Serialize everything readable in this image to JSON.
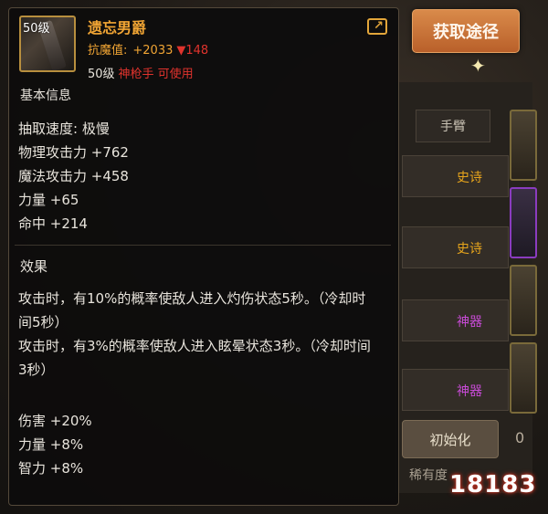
{
  "background": {
    "tab_weapon": "手臂",
    "rarity_rows": [
      {
        "label": "史诗",
        "color": "#e6a41c"
      },
      {
        "label": "史诗",
        "color": "#e6a41c"
      },
      {
        "label": "神器",
        "color": "#c84bd6"
      },
      {
        "label": "神器",
        "color": "#c84bd6"
      }
    ],
    "init_button": "初始化",
    "rarity_footer": "稀有度",
    "level_partial": "0"
  },
  "obtain_button": "获取途径",
  "item": {
    "icon_level": "50级",
    "name": "遗忘男爵",
    "resist_label": "抗魔值:",
    "resist_value": "+2033",
    "resist_diff": "▼148",
    "req_level": "50级",
    "req_class": "神枪手 可使用"
  },
  "basic_info": {
    "title": "基本信息",
    "stats": [
      "抽取速度: 极慢",
      "物理攻击力 +762",
      "魔法攻击力 +458",
      "力量 +65",
      "命中 +214"
    ]
  },
  "effects": {
    "title": "效果",
    "lines": [
      "攻击时，有10%的概率使敌人进入灼伤状态5秒。（冷却时间5秒）",
      "攻击时，有3%的概率使敌人进入眩晕状态3秒。（冷却时间3秒）"
    ],
    "bonuses": [
      "伤害 +20%",
      "力量 +8%",
      "智力 +8%"
    ]
  },
  "watermark": "18183",
  "colors": {
    "name": "#f1a534",
    "red": "#e0332d",
    "button": "#c8703a"
  }
}
